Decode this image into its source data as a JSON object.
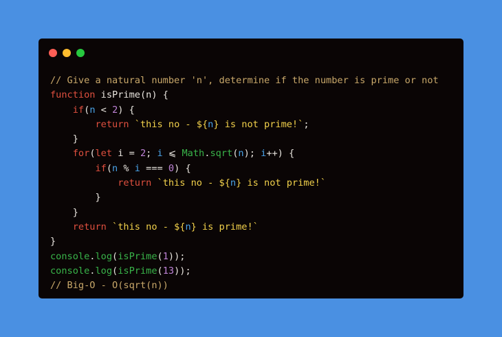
{
  "colors": {
    "background": "#4a90e2",
    "window": "#0a0505",
    "close": "#ff5f56",
    "minimize": "#ffbd2e",
    "maximize": "#27c93f"
  },
  "window_controls": [
    {
      "name": "close-button",
      "color": "#ff5f56"
    },
    {
      "name": "minimize-button",
      "color": "#ffbd2e"
    },
    {
      "name": "maximize-button",
      "color": "#27c93f"
    }
  ],
  "code_lines": [
    [
      {
        "t": "// Give a natural number 'n', determine if the number is prime or not",
        "c": "comment"
      }
    ],
    [
      {
        "t": "function",
        "c": "keyword"
      },
      {
        "t": " isPrime(n) {",
        "c": "plain"
      }
    ],
    [
      {
        "t": "    ",
        "c": "plain"
      },
      {
        "t": "if",
        "c": "keyword"
      },
      {
        "t": "(",
        "c": "plain"
      },
      {
        "t": "n",
        "c": "var"
      },
      {
        "t": " < ",
        "c": "plain"
      },
      {
        "t": "2",
        "c": "num"
      },
      {
        "t": ") {",
        "c": "plain"
      }
    ],
    [
      {
        "t": "        ",
        "c": "plain"
      },
      {
        "t": "return",
        "c": "keyword"
      },
      {
        "t": " `this no - ${",
        "c": "str"
      },
      {
        "t": "n",
        "c": "var"
      },
      {
        "t": "} is not prime!`",
        "c": "str"
      },
      {
        "t": ";",
        "c": "plain"
      }
    ],
    [
      {
        "t": "    }",
        "c": "plain"
      }
    ],
    [
      {
        "t": "    ",
        "c": "plain"
      },
      {
        "t": "for",
        "c": "keyword"
      },
      {
        "t": "(",
        "c": "plain"
      },
      {
        "t": "let",
        "c": "keyword"
      },
      {
        "t": " i = ",
        "c": "plain"
      },
      {
        "t": "2",
        "c": "num"
      },
      {
        "t": "; ",
        "c": "plain"
      },
      {
        "t": "i",
        "c": "var"
      },
      {
        "t": " ⩽ ",
        "c": "plain"
      },
      {
        "t": "Math",
        "c": "builtin"
      },
      {
        "t": ".",
        "c": "plain"
      },
      {
        "t": "sqrt",
        "c": "builtin"
      },
      {
        "t": "(",
        "c": "plain"
      },
      {
        "t": "n",
        "c": "var"
      },
      {
        "t": "); ",
        "c": "plain"
      },
      {
        "t": "i",
        "c": "var"
      },
      {
        "t": "++) {",
        "c": "plain"
      }
    ],
    [
      {
        "t": "        ",
        "c": "plain"
      },
      {
        "t": "if",
        "c": "keyword"
      },
      {
        "t": "(",
        "c": "plain"
      },
      {
        "t": "n",
        "c": "var"
      },
      {
        "t": " % ",
        "c": "plain"
      },
      {
        "t": "i",
        "c": "var"
      },
      {
        "t": " === ",
        "c": "plain"
      },
      {
        "t": "0",
        "c": "num"
      },
      {
        "t": ") {",
        "c": "plain"
      }
    ],
    [
      {
        "t": "            ",
        "c": "plain"
      },
      {
        "t": "return",
        "c": "keyword"
      },
      {
        "t": " `this no - ${",
        "c": "str"
      },
      {
        "t": "n",
        "c": "var"
      },
      {
        "t": "} is not prime!`",
        "c": "str"
      }
    ],
    [
      {
        "t": "        }",
        "c": "plain"
      }
    ],
    [
      {
        "t": "    }",
        "c": "plain"
      }
    ],
    [
      {
        "t": "    ",
        "c": "plain"
      },
      {
        "t": "return",
        "c": "keyword"
      },
      {
        "t": " `this no - ${",
        "c": "str"
      },
      {
        "t": "n",
        "c": "var"
      },
      {
        "t": "} is prime!`",
        "c": "str"
      }
    ],
    [
      {
        "t": "}",
        "c": "plain"
      }
    ],
    [
      {
        "t": "console",
        "c": "builtin"
      },
      {
        "t": ".",
        "c": "plain"
      },
      {
        "t": "log",
        "c": "builtin"
      },
      {
        "t": "(",
        "c": "plain"
      },
      {
        "t": "isPrime",
        "c": "builtin"
      },
      {
        "t": "(",
        "c": "plain"
      },
      {
        "t": "1",
        "c": "num"
      },
      {
        "t": "));",
        "c": "plain"
      }
    ],
    [
      {
        "t": "console",
        "c": "builtin"
      },
      {
        "t": ".",
        "c": "plain"
      },
      {
        "t": "log",
        "c": "builtin"
      },
      {
        "t": "(",
        "c": "plain"
      },
      {
        "t": "isPrime",
        "c": "builtin"
      },
      {
        "t": "(",
        "c": "plain"
      },
      {
        "t": "13",
        "c": "num"
      },
      {
        "t": "));",
        "c": "plain"
      }
    ],
    [
      {
        "t": "// Big-O - O(sqrt(n))",
        "c": "comment"
      }
    ]
  ]
}
